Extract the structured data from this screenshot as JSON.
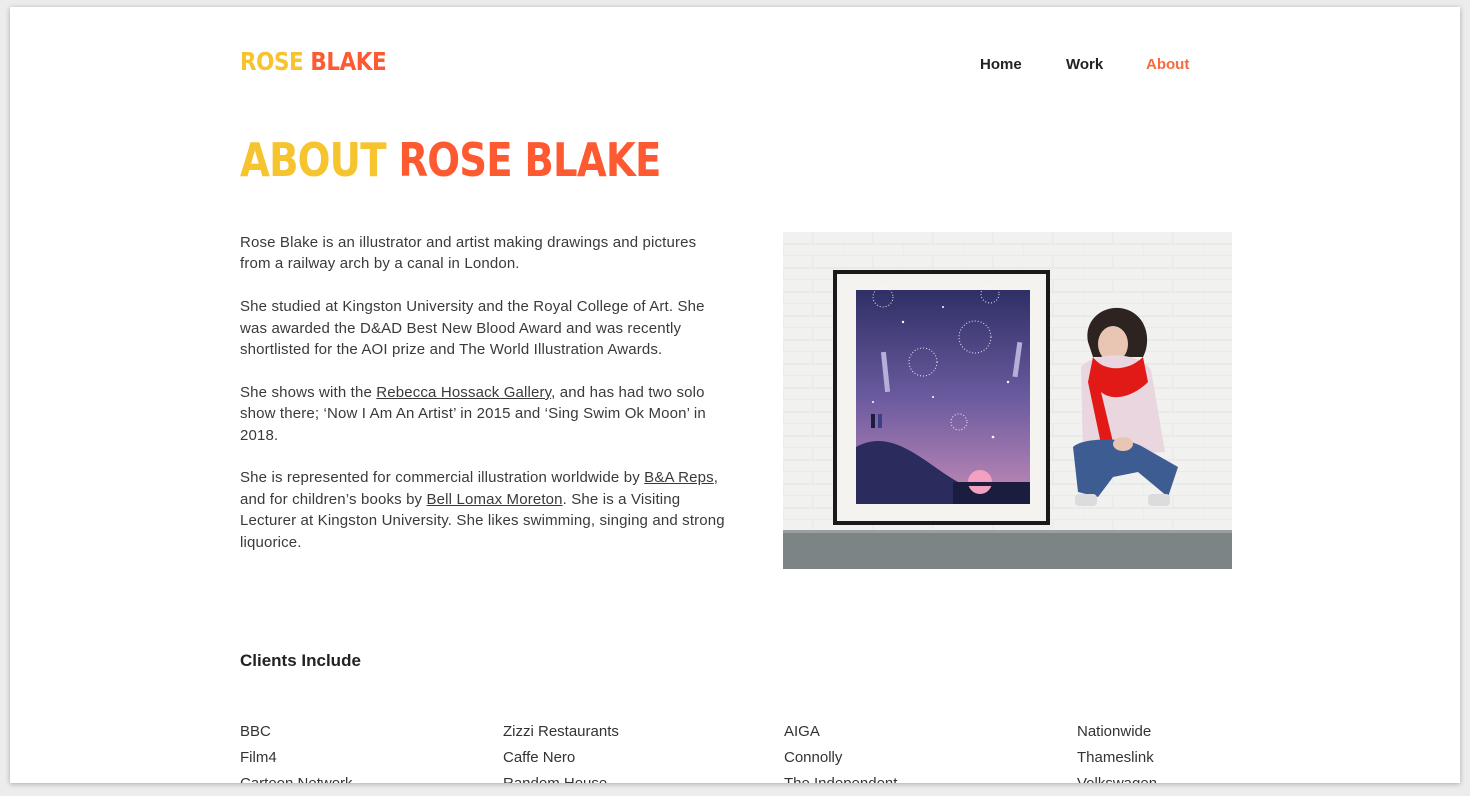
{
  "header": {
    "logo_part1": "ROSE",
    "logo_part2": "BLAKE",
    "nav": [
      {
        "label": "Home",
        "active": false
      },
      {
        "label": "Work",
        "active": false
      },
      {
        "label": "About",
        "active": true
      }
    ]
  },
  "page": {
    "title_part1": "ABOUT",
    "title_part2": "ROSE BLAKE"
  },
  "bio": {
    "p1": "Rose Blake is an illustrator and artist making drawings and pictures from a railway arch by a canal in London.",
    "p2": "She studied at Kingston University and the Royal College of Art. She was awarded the D&AD Best New Blood Award and was recently shortlisted for the AOI prize and The World Illustration Awards.",
    "p3_a": "She shows with the ",
    "p3_link": "Rebecca Hossack Gallery",
    "p3_b": ", and has had two solo show there; ‘Now I Am An Artist’ in 2015 and ‘Sing Swim Ok Moon’ in 2018.",
    "p4_a": "She is represented for commercial illustration worldwide by ",
    "p4_link1": "B&A Reps",
    "p4_b": ", and for children’s books by ",
    "p4_link2": "Bell Lomax Moreton",
    "p4_c": ". She is a Visiting Lecturer at Kingston University. She likes swimming, singing and strong liquorice."
  },
  "clients": {
    "heading": "Clients Include",
    "columns": [
      [
        "BBC",
        "Film4",
        "Cartoon Network"
      ],
      [
        "Zizzi Restaurants",
        "Caffe Nero",
        "Random House"
      ],
      [
        "AIGA",
        "Connolly",
        "The Independent"
      ],
      [
        "Nationwide",
        "Thameslink",
        "Volkswagen"
      ]
    ]
  },
  "colors": {
    "logo_yellow": "#f5c42e",
    "logo_orange": "#fd5a32",
    "nav_active": "#f86a3b",
    "background": "#ffffff"
  }
}
